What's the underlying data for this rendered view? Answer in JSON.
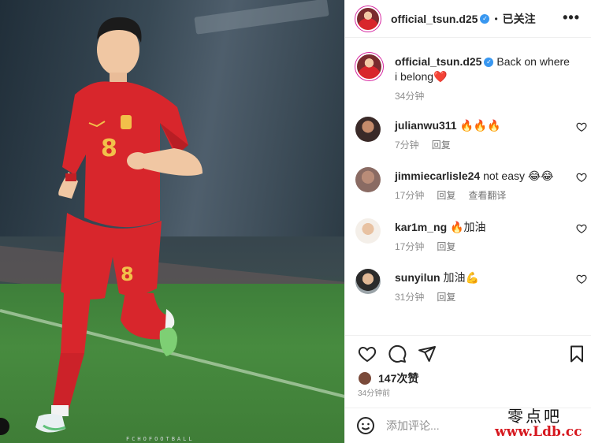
{
  "post": {
    "username": "official_tsun.d25",
    "verified_mark": "✓",
    "separator": "•",
    "follow_status": "已关注",
    "more_icon": "more-icon",
    "caption": "Back on where i belong",
    "caption_emoji": "❤️",
    "caption_time": "34分钟"
  },
  "comments": [
    {
      "user": "julianwu311",
      "text": "🔥🔥🔥",
      "time": "7分钟",
      "reply": "回复",
      "translate": ""
    },
    {
      "user": "jimmiecarlisle24",
      "text": "not easy 😂😂",
      "time": "17分钟",
      "reply": "回复",
      "translate": "查看翻译"
    },
    {
      "user": "kar1m_ng",
      "text": "🔥加油",
      "time": "17分钟",
      "reply": "回复",
      "translate": ""
    },
    {
      "user": "sunyilun",
      "text": "加油💪",
      "time": "31分钟",
      "reply": "回复",
      "translate": ""
    }
  ],
  "actions": {
    "likes": "147次赞",
    "posted_ago": "34分钟前",
    "comment_placeholder": "添加评论..."
  },
  "photo": {
    "jersey_number": "8",
    "watermark": "FCHOFOOTBALL"
  },
  "watermark_site": {
    "line1": "零点吧",
    "line2": "www.Ldb.cc"
  },
  "colors": {
    "jersey": "#d8262c",
    "accent_blue": "#3897f0",
    "pitch": "#478b3f"
  }
}
